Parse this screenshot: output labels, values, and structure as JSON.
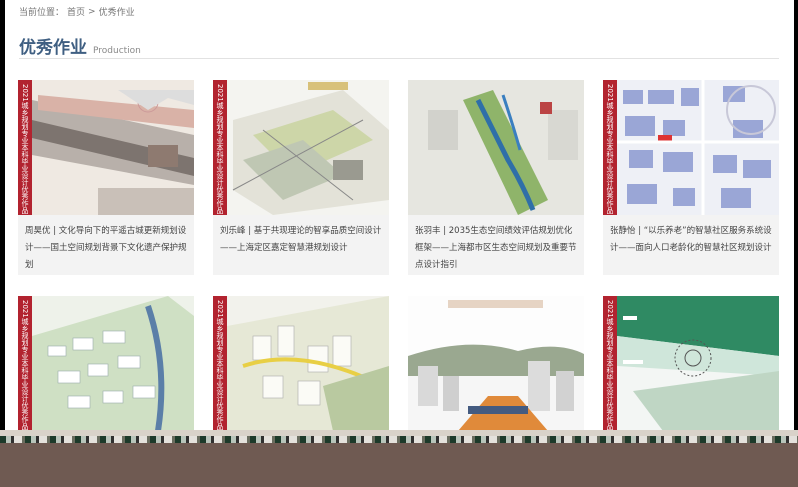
{
  "breadcrumb": {
    "prefix": "当前位置：",
    "home": "首页",
    "separator": ">",
    "current": "优秀作业"
  },
  "header": {
    "title": "优秀作业",
    "subtitle": "Production"
  },
  "works": [
    {
      "caption": "周昊优 | 文化导向下的平遥古城更新规划设计——国土空间规划背景下文化遗产保护规划",
      "ribbon": "2021城乡规划专业本科毕业设计优秀作品"
    },
    {
      "caption": "刘乐峰 | 基于共现理论的智享品质空间设计——上海定区嘉定智慧港规划设计",
      "ribbon": "2021城乡规划专业本科毕业设计优秀作品"
    },
    {
      "caption": "张羽丰 | 2035生态空间绩效评估规划优化框架——上海都市区生态空间规划及重要节点设计指引",
      "ribbon": ""
    },
    {
      "caption": "张静怡 | “以乐养老”的智慧社区服务系统设计——面向人口老龄化的智慧社区规划设计",
      "ribbon": "2021城乡规划专业本科毕业设计优秀作品"
    },
    {
      "caption": "",
      "ribbon": "2021城乡规划专业本科毕业设计优秀作品"
    },
    {
      "caption": "",
      "ribbon": "2021城乡规划专业本科毕业设计优秀作品"
    },
    {
      "caption": "",
      "ribbon": ""
    },
    {
      "caption": "",
      "ribbon": "2021城乡规划专业本科毕业设计优秀作品"
    }
  ],
  "colors": {
    "title": "#3f5f82",
    "ribbon": "#b2232f",
    "card_bg": "#f3f3f3"
  }
}
